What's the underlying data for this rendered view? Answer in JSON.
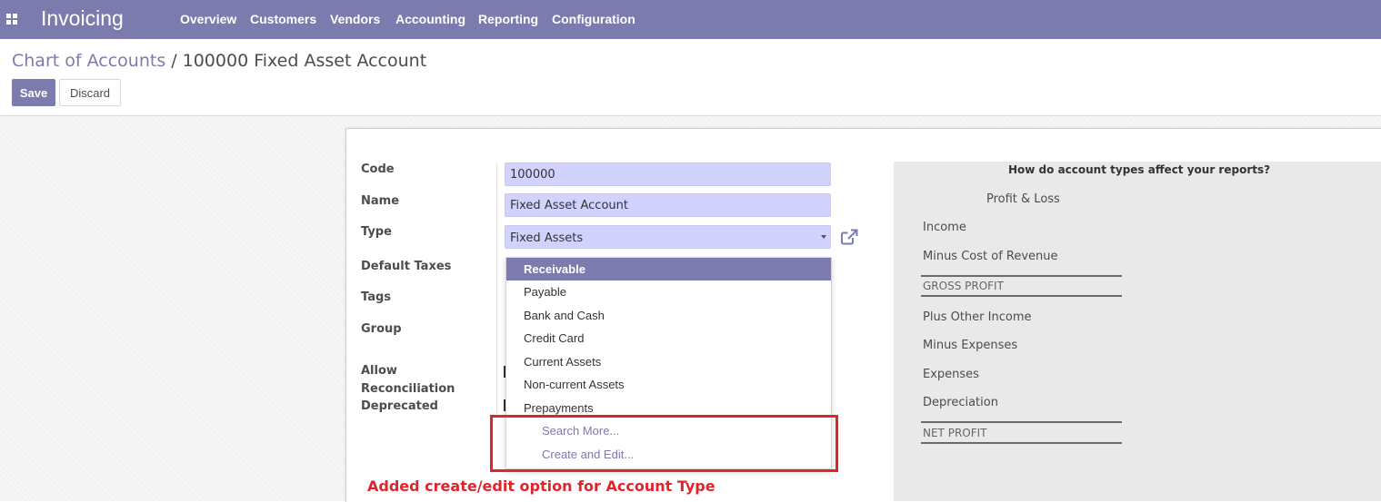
{
  "app": {
    "title": "Invoicing"
  },
  "menu": [
    "Overview",
    "Customers",
    "Vendors",
    "Accounting",
    "Reporting",
    "Configuration"
  ],
  "breadcrumb": {
    "parent": "Chart of Accounts",
    "separator": "/",
    "current": "100000 Fixed Asset Account"
  },
  "buttons": {
    "save": "Save",
    "discard": "Discard"
  },
  "form": {
    "labels": {
      "code": "Code",
      "name": "Name",
      "type": "Type",
      "default_taxes": "Default Taxes",
      "tags": "Tags",
      "group": "Group",
      "allow_reconciliation_1": "Allow",
      "allow_reconciliation_2": "Reconciliation",
      "deprecated": "Deprecated"
    },
    "values": {
      "code": "100000",
      "name": "Fixed Asset Account",
      "type": "Fixed Assets"
    }
  },
  "dropdown": {
    "items": [
      "Receivable",
      "Payable",
      "Bank and Cash",
      "Credit Card",
      "Current Assets",
      "Non-current Assets",
      "Prepayments"
    ],
    "active_item": "Receivable",
    "search_more": "Search More...",
    "create_and_edit": "Create and Edit..."
  },
  "annotation": {
    "text": "Added create/edit option for Account Type",
    "color": "#e0242b"
  },
  "help": {
    "title": "How do account types affect your reports?",
    "section": "Profit & Loss",
    "items": [
      "Income",
      "Minus Cost of Revenue",
      "GROSS PROFIT",
      "Plus Other Income",
      "Minus Expenses",
      "Expenses",
      "Depreciation",
      "NET PROFIT"
    ]
  },
  "colors": {
    "brand": "#7c7bad",
    "field_bg": "#d2d2ff",
    "help_bg": "#e9e9e9"
  },
  "icons": {
    "apps": "apps-grid-icon",
    "external": "external-link-icon",
    "caret": "caret-down-icon"
  }
}
